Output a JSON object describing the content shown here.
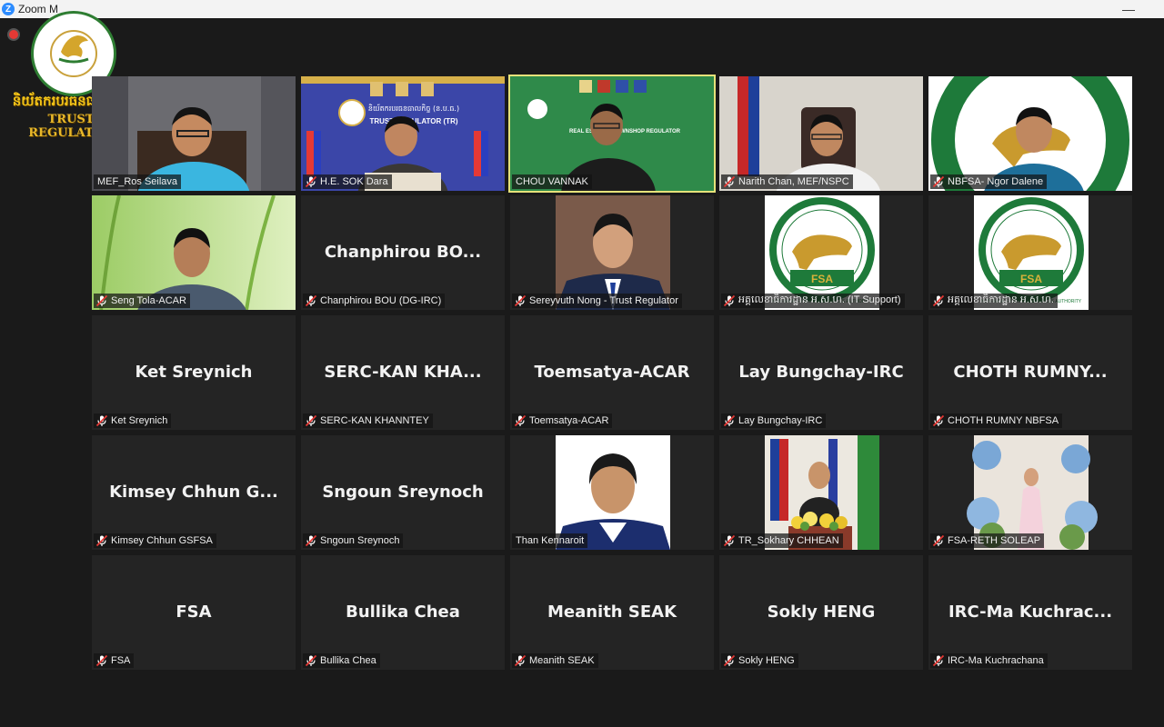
{
  "window": {
    "app_title": "Zoom M",
    "logo_letter": "Z"
  },
  "org_logo": {
    "khmer": "និយ័តករបរធនធាលកិច្ច",
    "english": "TRUST REGULATOR"
  },
  "colors": {
    "accent_border": "#e6e27a",
    "muted_mic": "#e53935",
    "tile_bg": "#242424"
  },
  "rows": [
    [
      {
        "label": "MEF_Ros Seilava",
        "kind": "video",
        "muted": false
      },
      {
        "label": "H.E. SOK Dara",
        "kind": "video",
        "muted": true
      },
      {
        "label": "CHOU VANNAK",
        "kind": "video",
        "muted": false,
        "active": true
      },
      {
        "label": "Narith Chan, MEF/NSPC",
        "kind": "video",
        "muted": true
      },
      {
        "label": "NBFSA- Ngor Dalene",
        "kind": "video",
        "muted": true
      }
    ],
    [
      {
        "label": "Seng Tola-ACAR",
        "kind": "video",
        "muted": true
      },
      {
        "label": "Chanphirou BOU (DG-IRC)",
        "kind": "name",
        "display": "Chanphirou  BO...",
        "muted": true
      },
      {
        "label": "Sereyvuth Nong - Trust Regulator",
        "kind": "photo",
        "muted": true
      },
      {
        "label": "អគ្គលេខាធិការដ្ឋាន អ.ស.ហ. (IT Support)",
        "kind": "logo",
        "muted": true
      },
      {
        "label": "អគ្គលេខាធិការដ្ឋាន អ.ស.ហ.",
        "kind": "logo",
        "muted": true
      }
    ],
    [
      {
        "label": "Ket Sreynich",
        "kind": "name",
        "display": "Ket Sreynich",
        "muted": true
      },
      {
        "label": "SERC-KAN KHANNTEY",
        "kind": "name",
        "display": "SERC-KAN  KHA...",
        "muted": true
      },
      {
        "label": "Toemsatya-ACAR",
        "kind": "name",
        "display": "Toemsatya-ACAR",
        "muted": true
      },
      {
        "label": "Lay Bungchay-IRC",
        "kind": "name",
        "display": "Lay Bungchay-IRC",
        "muted": true
      },
      {
        "label": "CHOTH RUMNY NBFSA",
        "kind": "name",
        "display": "CHOTH  RUMNY...",
        "muted": true
      }
    ],
    [
      {
        "label": "Kimsey Chhun GSFSA",
        "kind": "name",
        "display": "Kimsey  Chhun  G...",
        "muted": true
      },
      {
        "label": "Sngoun Sreynoch",
        "kind": "name",
        "display": "Sngoun Sreynoch",
        "muted": true
      },
      {
        "label": "Than Kennaroit",
        "kind": "photo-female",
        "muted": false
      },
      {
        "label": "TR_Sokhary CHHEAN",
        "kind": "photo-podium",
        "muted": true
      },
      {
        "label": "FSA-RETH SOLEAP",
        "kind": "photo-event",
        "muted": true
      }
    ],
    [
      {
        "label": "FSA",
        "kind": "name",
        "display": "FSA",
        "muted": true
      },
      {
        "label": "Bullika Chea",
        "kind": "name",
        "display": "Bullika Chea",
        "muted": true
      },
      {
        "label": "Meanith SEAK",
        "kind": "name",
        "display": "Meanith SEAK",
        "muted": true
      },
      {
        "label": "Sokly HENG",
        "kind": "name",
        "display": "Sokly HENG",
        "muted": true
      },
      {
        "label": "IRC-Ma Kuchrachana",
        "kind": "name",
        "display": "IRC-Ma  Kuchrac...",
        "muted": true
      }
    ]
  ],
  "backdrops": {
    "tr_banner_km": "និយ័តករបរធនធាលកិច្ច (ន.ប.ធ.)",
    "tr_banner_en": "TRUST REGULATOR (TR)",
    "acar_banner": "REAL ESTATE & PAWNSHOP REGULATOR",
    "fsa_badge": "FSA",
    "fsa_ring": "NON-BANK FINANCIAL SERVICES AUTHORITY"
  }
}
